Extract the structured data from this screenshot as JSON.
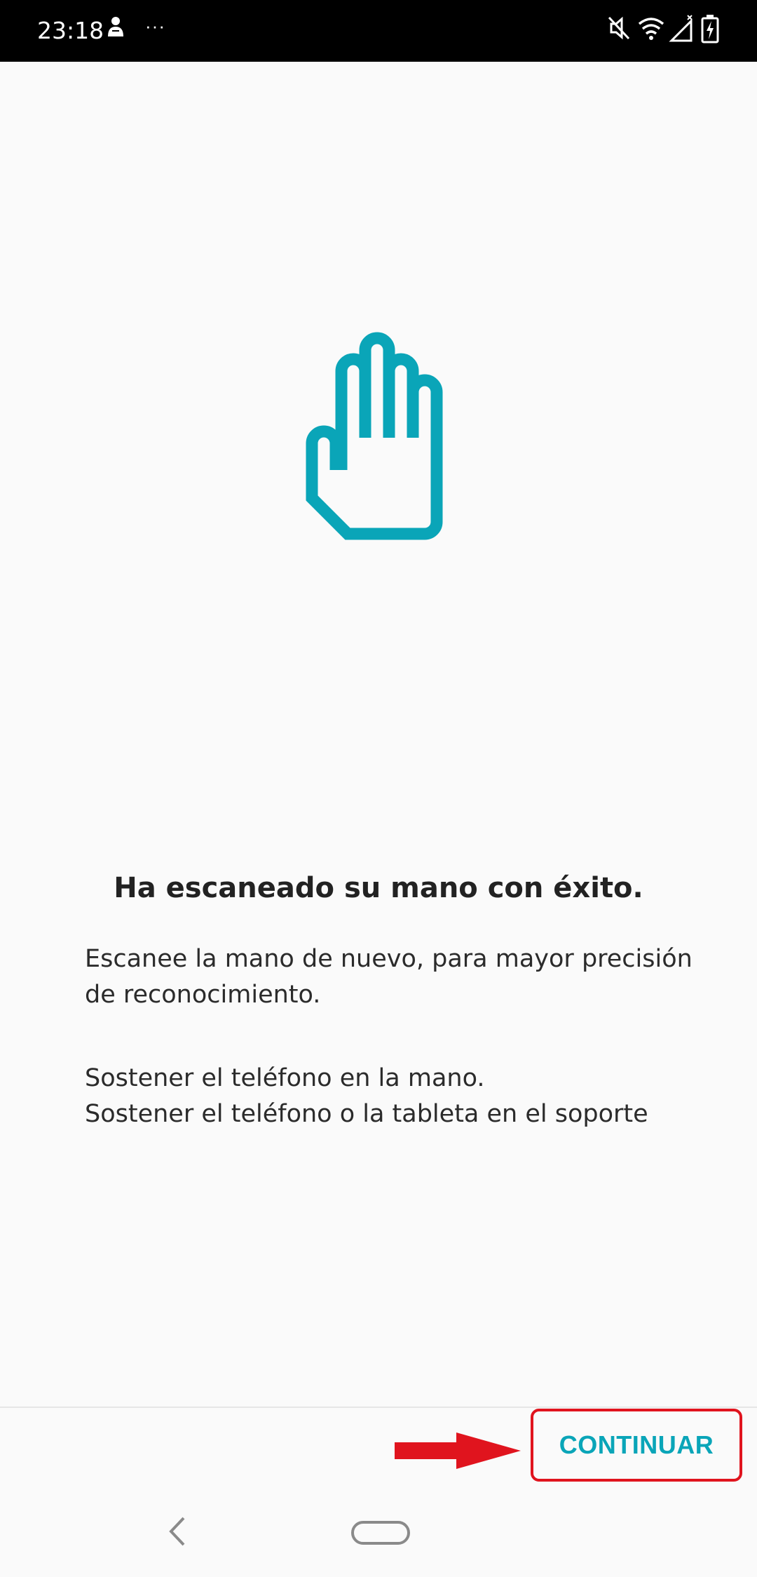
{
  "status_bar": {
    "time": "23:18",
    "dots": "···",
    "icons": [
      "notification-person-icon",
      "mute-icon",
      "wifi-icon",
      "signal-icon",
      "battery-charging-icon"
    ]
  },
  "main": {
    "icon": "hand-icon",
    "title": "Ha escaneado su mano con éxito.",
    "description_lines": [
      "Escanee la mano de nuevo, para mayor precisión",
      "de reconocimiento."
    ],
    "option_lines": [
      "Sostener el teléfono en la mano.",
      "Sostener el teléfono o la tableta en el soporte"
    ]
  },
  "footer": {
    "continue_label": "CONTINUAR"
  },
  "colors": {
    "accent": "#0aa5b8",
    "highlight": "#e0141e",
    "background": "#fafafa"
  }
}
